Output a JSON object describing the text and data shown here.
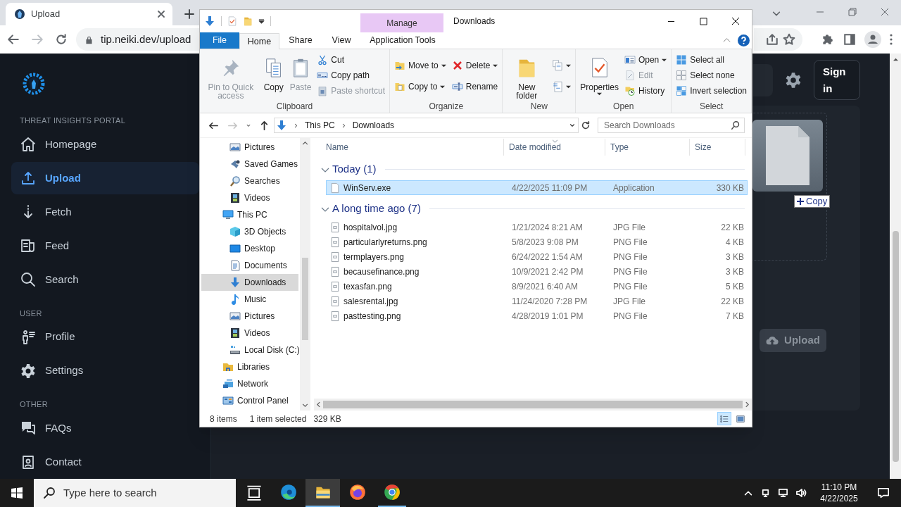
{
  "browser": {
    "tab_title": "Upload",
    "url": "tip.neiki.dev/upload"
  },
  "sidebar": {
    "groups": [
      {
        "heading": "THREAT INSIGHTS PORTAL",
        "items": [
          {
            "label": "Homepage",
            "kind": "home",
            "selected": false
          },
          {
            "label": "Upload",
            "kind": "upload",
            "selected": true
          },
          {
            "label": "Fetch",
            "kind": "fetch",
            "selected": false
          },
          {
            "label": "Feed",
            "kind": "feed",
            "selected": false
          },
          {
            "label": "Search",
            "kind": "search",
            "selected": false
          }
        ]
      },
      {
        "heading": "USER",
        "items": [
          {
            "label": "Profile",
            "kind": "profile",
            "selected": false
          },
          {
            "label": "Settings",
            "kind": "settings",
            "selected": false
          }
        ]
      },
      {
        "heading": "OTHER",
        "items": [
          {
            "label": "FAQs",
            "kind": "faq",
            "selected": false
          },
          {
            "label": "Contact",
            "kind": "contact",
            "selected": false
          }
        ]
      }
    ]
  },
  "header": {
    "sign_in": "Sign in"
  },
  "upload_panel": {
    "drag_badge": "Copy",
    "upload_button": {
      "label": "Upload",
      "disabled": true
    }
  },
  "explorer": {
    "title": "Downloads",
    "tabs": [
      {
        "label": "File",
        "kind": "file",
        "selected": false
      },
      {
        "label": "Home",
        "kind": "tab",
        "selected": true
      },
      {
        "label": "Share",
        "kind": "tab",
        "selected": false
      },
      {
        "label": "View",
        "kind": "tab",
        "selected": false
      }
    ],
    "context_tab": {
      "group": "Manage",
      "label": "Application Tools",
      "selected": false
    },
    "ribbon": [
      {
        "name": "Clipboard",
        "columns": [
          [
            {
              "label": "Pin to Quick access",
              "kind": "pin",
              "large": true,
              "disabled": true,
              "dropdown": false
            }
          ],
          [
            {
              "label": "Copy",
              "kind": "copy",
              "large": true,
              "disabled": false,
              "dropdown": false
            }
          ],
          [
            {
              "label": "Paste",
              "kind": "paste",
              "large": true,
              "disabled": true,
              "dropdown": false
            }
          ],
          [
            {
              "label": "Cut",
              "kind": "cut",
              "large": false,
              "disabled": false,
              "dropdown": false
            },
            {
              "label": "Copy path",
              "kind": "copypath",
              "large": false,
              "disabled": false,
              "dropdown": false
            },
            {
              "label": "Paste shortcut",
              "kind": "pasteshortcut",
              "large": false,
              "disabled": true,
              "dropdown": false
            }
          ]
        ]
      },
      {
        "name": "Organize",
        "columns": [
          [
            {
              "label": "Move to",
              "kind": "moveto",
              "large": false,
              "disabled": false,
              "dropdown": true
            },
            {
              "label": "Copy to",
              "kind": "copyto",
              "large": false,
              "disabled": false,
              "dropdown": true
            }
          ],
          [
            {
              "label": "Delete",
              "kind": "delete",
              "large": false,
              "disabled": false,
              "dropdown": true
            },
            {
              "label": "Rename",
              "kind": "rename",
              "large": false,
              "disabled": false,
              "dropdown": false
            }
          ]
        ]
      },
      {
        "name": "New",
        "columns": [
          [
            {
              "label": "New folder",
              "kind": "newfolder",
              "large": true,
              "disabled": false,
              "dropdown": false
            }
          ],
          [
            {
              "kind": "newitem",
              "large": false,
              "disabled": false,
              "dropdown": true
            },
            {
              "kind": "easyaccess",
              "large": false,
              "disabled": false,
              "dropdown": true
            }
          ]
        ]
      },
      {
        "name": "Open",
        "columns": [
          [
            {
              "label": "Properties",
              "kind": "properties",
              "large": true,
              "disabled": false,
              "dropdown": true
            }
          ],
          [
            {
              "label": "Open",
              "kind": "open",
              "large": false,
              "disabled": false,
              "dropdown": true
            },
            {
              "label": "Edit",
              "kind": "edit",
              "large": false,
              "disabled": true,
              "dropdown": false
            },
            {
              "label": "History",
              "kind": "history",
              "large": false,
              "disabled": false,
              "dropdown": false
            }
          ]
        ]
      },
      {
        "name": "Select",
        "columns": [
          [
            {
              "label": "Select all",
              "kind": "selectall",
              "large": false,
              "disabled": false,
              "dropdown": false
            },
            {
              "label": "Select none",
              "kind": "selectnone",
              "large": false,
              "disabled": false,
              "dropdown": false
            },
            {
              "label": "Invert selection",
              "kind": "invert",
              "large": false,
              "disabled": false,
              "dropdown": false
            }
          ]
        ]
      }
    ],
    "path": [
      "This PC",
      "Downloads"
    ],
    "search_placeholder": "Search Downloads",
    "nav": [
      {
        "children": [
          {
            "label": "Pictures",
            "kind": "pictures",
            "selected": false
          },
          {
            "label": "Saved Games",
            "kind": "games",
            "selected": false
          },
          {
            "label": "Searches",
            "kind": "searches",
            "selected": false
          },
          {
            "label": "Videos",
            "kind": "videos",
            "selected": false
          }
        ]
      },
      {
        "label": "This PC",
        "kind": "pc",
        "selected": false,
        "children": [
          {
            "label": "3D Objects",
            "kind": "objects",
            "selected": false
          },
          {
            "label": "Desktop",
            "kind": "desktop",
            "selected": false
          },
          {
            "label": "Documents",
            "kind": "documents",
            "selected": false
          },
          {
            "label": "Downloads",
            "kind": "downloads",
            "selected": true
          },
          {
            "label": "Music",
            "kind": "music",
            "selected": false
          },
          {
            "label": "Pictures",
            "kind": "pictures",
            "selected": false
          },
          {
            "label": "Videos",
            "kind": "videos",
            "selected": false
          },
          {
            "label": "Local Disk (C:)",
            "kind": "disk",
            "selected": false
          }
        ]
      },
      {
        "label": "Libraries",
        "kind": "libraries",
        "selected": false
      },
      {
        "label": "Network",
        "kind": "network",
        "selected": false
      },
      {
        "label": "Control Panel",
        "kind": "control",
        "selected": false
      }
    ],
    "columns": [
      {
        "label": "Name",
        "sorted": false
      },
      {
        "label": "Date modified",
        "sorted": true
      },
      {
        "label": "Type",
        "sorted": false
      },
      {
        "label": "Size",
        "sorted": false
      }
    ],
    "groups": [
      {
        "title": "Today (1)",
        "expanded": true,
        "files": [
          {
            "name": "WinServ.exe",
            "date": "4/22/2025 11:09 PM",
            "type": "Application",
            "size": "330 KB",
            "kind": "exe",
            "selected": true
          }
        ]
      },
      {
        "title": "A long time ago (7)",
        "expanded": true,
        "files": [
          {
            "name": "hospitalvol.jpg",
            "date": "1/21/2024 8:21 AM",
            "type": "JPG File",
            "size": "22 KB",
            "kind": "image",
            "selected": false
          },
          {
            "name": "particularlyreturns.png",
            "date": "5/8/2023 9:08 PM",
            "type": "PNG File",
            "size": "4 KB",
            "kind": "image",
            "selected": false
          },
          {
            "name": "termplayers.png",
            "date": "6/24/2022 1:54 AM",
            "type": "PNG File",
            "size": "3 KB",
            "kind": "image",
            "selected": false
          },
          {
            "name": "becausefinance.png",
            "date": "10/9/2021 2:42 PM",
            "type": "PNG File",
            "size": "3 KB",
            "kind": "image",
            "selected": false
          },
          {
            "name": "texasfan.png",
            "date": "8/9/2021 6:40 AM",
            "type": "PNG File",
            "size": "5 KB",
            "kind": "image",
            "selected": false
          },
          {
            "name": "salesrental.jpg",
            "date": "11/24/2020 7:28 PM",
            "type": "JPG File",
            "size": "22 KB",
            "kind": "image",
            "selected": false
          },
          {
            "name": "pasttesting.png",
            "date": "4/28/2019 1:01 PM",
            "type": "PNG File",
            "size": "7 KB",
            "kind": "image",
            "selected": false
          }
        ]
      }
    ],
    "status": {
      "count": "8 items",
      "selection": "1 item selected",
      "size": "329 KB"
    },
    "views": [
      {
        "kind": "details",
        "selected": true
      },
      {
        "kind": "large",
        "selected": false
      }
    ]
  },
  "taskbar": {
    "search_placeholder": "Type here to search",
    "apps": [
      {
        "kind": "taskview",
        "active": false,
        "running": false
      },
      {
        "kind": "edge",
        "active": false,
        "running": false
      },
      {
        "kind": "explorer",
        "active": true,
        "running": true
      },
      {
        "kind": "firefox",
        "active": false,
        "running": false
      },
      {
        "kind": "chrome",
        "active": false,
        "running": true
      }
    ],
    "time": "11:10 PM",
    "date": "4/22/2025"
  }
}
